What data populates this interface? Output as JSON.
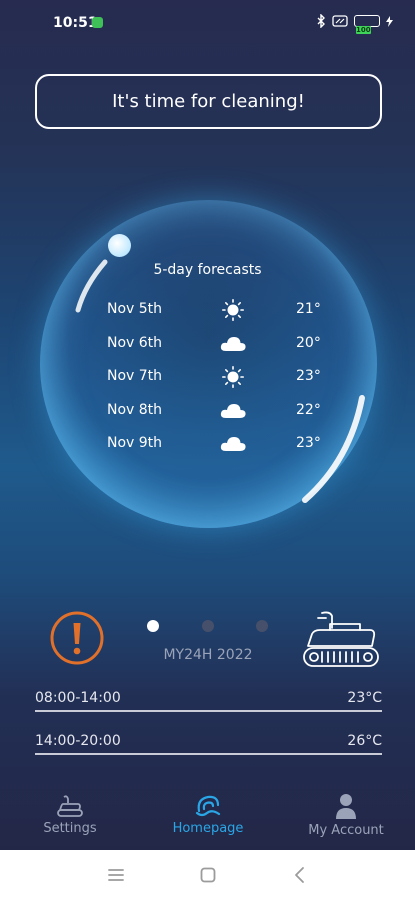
{
  "status": {
    "time": "10:51",
    "battery": "100"
  },
  "banner": {
    "text": "It's time for cleaning!"
  },
  "forecast": {
    "title": "5-day forecasts",
    "days": [
      {
        "date": "Nov 5th",
        "icon": "sun-icon",
        "temp": "21°"
      },
      {
        "date": "Nov 6th",
        "icon": "cloud-icon",
        "temp": "20°"
      },
      {
        "date": "Nov 7th",
        "icon": "sun-icon",
        "temp": "23°"
      },
      {
        "date": "Nov 8th",
        "icon": "cloud-icon",
        "temp": "22°"
      },
      {
        "date": "Nov 9th",
        "icon": "cloud-icon",
        "temp": "23°"
      }
    ]
  },
  "device": {
    "name": "MY24H 2022",
    "pages": 3,
    "active_page": 1
  },
  "periods": [
    {
      "time": "08:00-14:00",
      "temp": "23°C"
    },
    {
      "time": "14:00-20:00",
      "temp": "26°C"
    }
  ],
  "nav": {
    "settings": "Settings",
    "homepage": "Homepage",
    "account": "My Account"
  },
  "colors": {
    "accent": "#2aa6e6",
    "alert": "#e0702a",
    "inactive": "#9aa3b8"
  }
}
